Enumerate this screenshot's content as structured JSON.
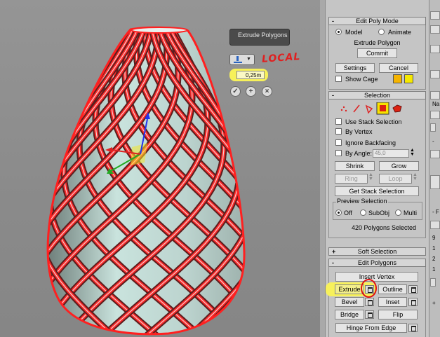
{
  "caddy": {
    "title": "Extrude Polygons",
    "type_icon": "extrude-type-icon",
    "amount": "0,25m",
    "ok_icon": "check-icon",
    "apply_icon": "plus-icon",
    "cancel_icon": "x-icon",
    "annotation": "LOCAL"
  },
  "colors": {
    "highlight": "#f7f15a",
    "annotation_red": "#e02020",
    "edge_selection": "#ff2020",
    "glass": "#c9e3dd",
    "cage_swatch_1": "#f5b400",
    "cage_swatch_2": "#f5e800"
  },
  "edit_poly_mode": {
    "title": "Edit Poly Mode",
    "model_label": "Model",
    "animate_label": "Animate",
    "selected_mode": "Model",
    "operation": "Extrude Polygon",
    "commit": "Commit",
    "settings": "Settings",
    "cancel": "Cancel",
    "show_cage": "Show Cage"
  },
  "selection": {
    "title": "Selection",
    "levels": [
      "vertex-icon",
      "edge-icon",
      "border-icon",
      "polygon-icon",
      "element-icon"
    ],
    "active_level": "polygon-icon",
    "use_stack_selection": "Use Stack Selection",
    "by_vertex": "By Vertex",
    "ignore_backfacing": "Ignore Backfacing",
    "by_angle": "By Angle:",
    "angle_value": "45,0",
    "shrink": "Shrink",
    "grow": "Grow",
    "ring": "Ring",
    "loop": "Loop",
    "get_stack_selection": "Get Stack Selection",
    "preview_title": "Preview Selection",
    "preview_off": "Off",
    "preview_subobj": "SubObj",
    "preview_multi": "Multi",
    "preview_selected": "Off",
    "status": "420 Polygons Selected"
  },
  "soft_selection": {
    "title": "Soft Selection"
  },
  "edit_polygons": {
    "title": "Edit Polygons",
    "insert_vertex": "Insert Vertex",
    "extrude": "Extrude",
    "outline": "Outline",
    "bevel": "Bevel",
    "inset": "Inset",
    "bridge": "Bridge",
    "flip": "Flip",
    "hinge_from_edge": "Hinge From Edge"
  },
  "right_strip": {
    "labels": [
      "Na",
      "9",
      "1",
      "2",
      "1"
    ],
    "minus_1": "-",
    "minus_2": "- F",
    "plus": "+"
  }
}
